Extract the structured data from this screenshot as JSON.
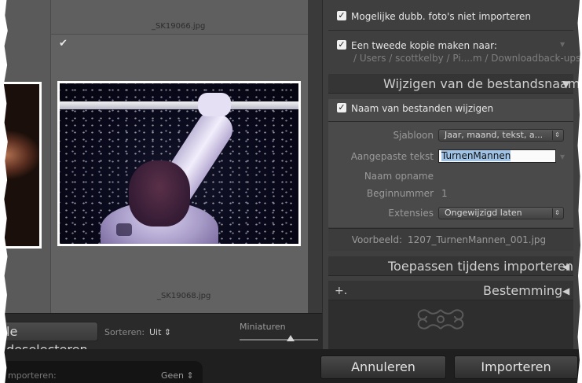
{
  "grid": {
    "filename_top": "_SK19066.jpg",
    "filename_bottom": "_SK19068.jpg",
    "checkmark": "✔"
  },
  "grid_toolbar": {
    "deselect_label": "le deselecteren",
    "sort_label": "Sorteren:",
    "sort_value": "Uit ⇕",
    "thumbnails_label": "Miniaturen"
  },
  "bottom": {
    "import_label": "mporteren:",
    "import_value": "Geen ⇕",
    "cancel_label": "Annuleren",
    "import_button_label": "Importeren"
  },
  "right_panel": {
    "options": {
      "duplicates_label": "Mogelijke dubb. foto's niet importeren",
      "duplicates_checked": true,
      "second_copy_label": "Een tweede kopie maken naar:",
      "second_copy_checked": true,
      "second_copy_path": "/ Users / scottkelby / Pi....m / Downloadback-ups"
    },
    "rename_section": {
      "title": "Wijzigen van de bestandsnaam",
      "tri": "▼",
      "rename_label": "Naam van bestanden wijzigen",
      "rename_checked": true,
      "template_label": "Sjabloon",
      "template_value": "Jaar, maand, tekst, a...",
      "custom_text_label": "Aangepaste tekst",
      "custom_text_value": "TurnenMannen",
      "shoot_name_label": "Naam opname",
      "start_number_label": "Beginnummer",
      "start_number_value": "1",
      "extensions_label": "Extensies",
      "extensions_value": "Ongewijzigd laten",
      "preview_label": "Voorbeeld:",
      "preview_value": "1207_TurnenMannen_001.jpg"
    },
    "apply_section": {
      "title": "Toepassen tijdens importeren",
      "tri": "◀"
    },
    "destination_section": {
      "title": "Bestemming",
      "tri": "◀",
      "plus": "+."
    }
  },
  "colors": {
    "panel_bg": "#3f3f3f",
    "grid_bg": "#5c5c5c",
    "text_light": "#e6e6e6",
    "text_dim": "#9a9a9a",
    "selection": "#9fc3e6"
  }
}
